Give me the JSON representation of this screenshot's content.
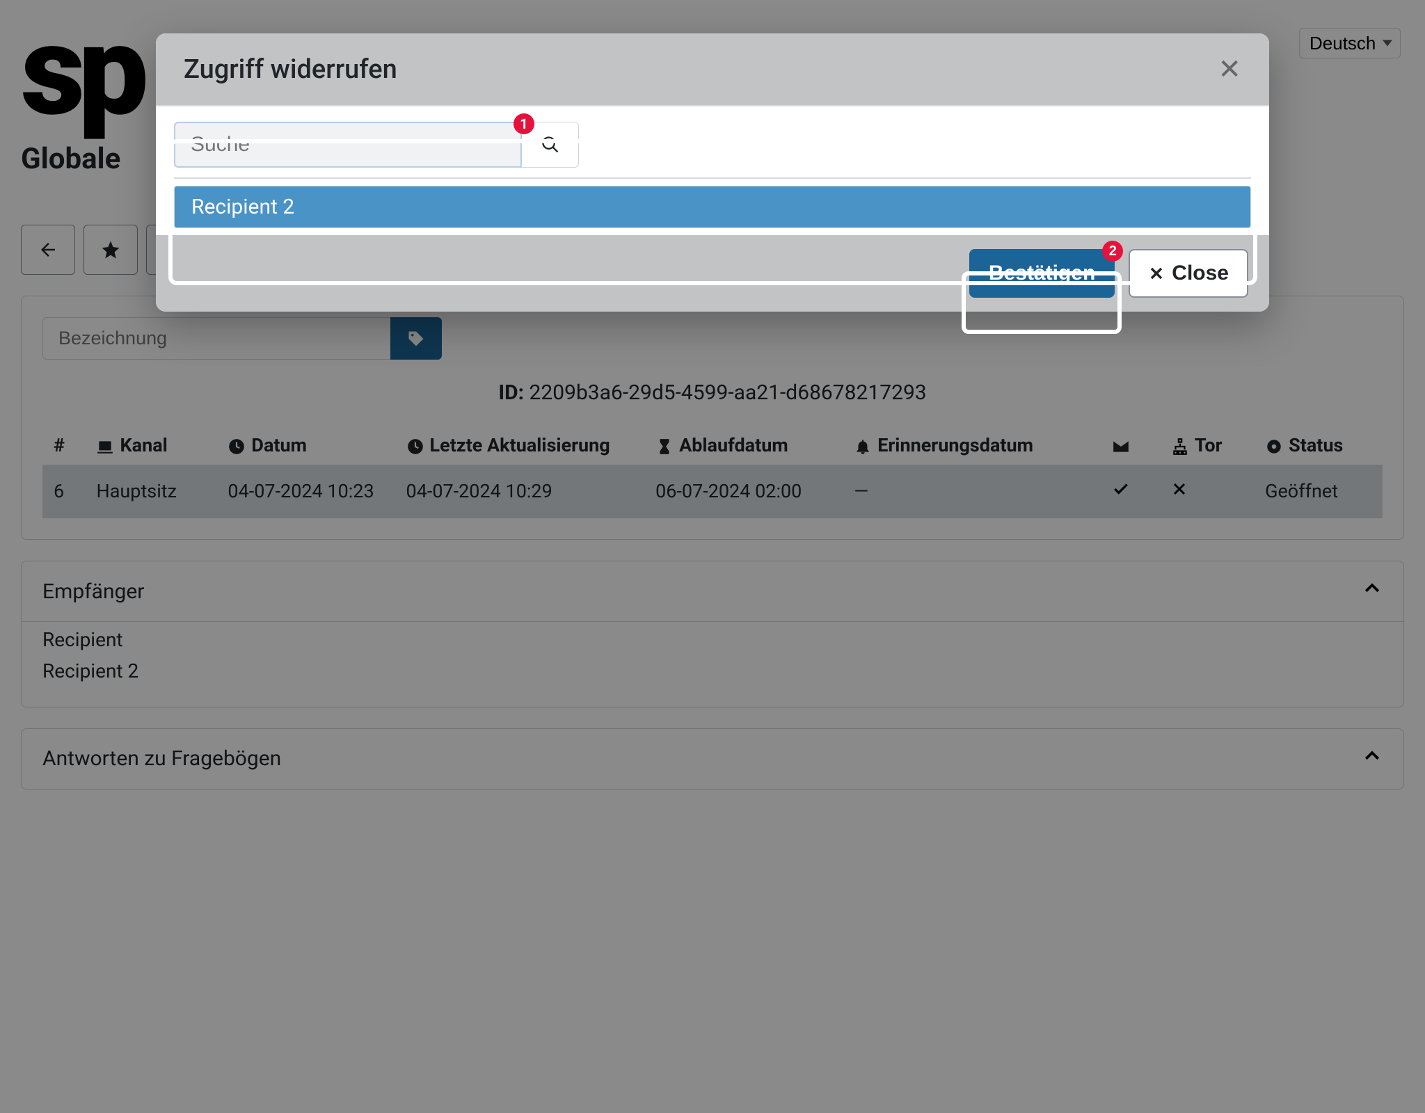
{
  "lang": {
    "selected": "Deutsch"
  },
  "page_title_prefix": "Globale",
  "label_input_placeholder": "Bezeichnung",
  "id_label": "ID:",
  "id_value": "2209b3a6-29d5-4599-aa21-d68678217293",
  "columns": {
    "num": "#",
    "channel": "Kanal",
    "date": "Datum",
    "updated": "Letzte Aktualisierung",
    "expiry": "Ablaufdatum",
    "reminder": "Erinnerungsdatum",
    "tor": "Tor",
    "status": "Status"
  },
  "row": {
    "num": "6",
    "channel": "Hauptsitz",
    "date": "04-07-2024 10:23",
    "updated": "04-07-2024 10:29",
    "expiry": "06-07-2024 02:00",
    "reminder": "—",
    "status": "Geöffnet"
  },
  "accordion": {
    "recipients_title": "Empfänger",
    "recipient_a": "Recipient",
    "recipient_b": "Recipient 2",
    "answers_title": "Antworten zu Fragebögen"
  },
  "modal": {
    "title": "Zugriff widerrufen",
    "search_placeholder": "Suche",
    "option": "Recipient 2",
    "confirm": "Bestätigen",
    "close": "Close",
    "badge_search": "1",
    "badge_confirm": "2"
  }
}
